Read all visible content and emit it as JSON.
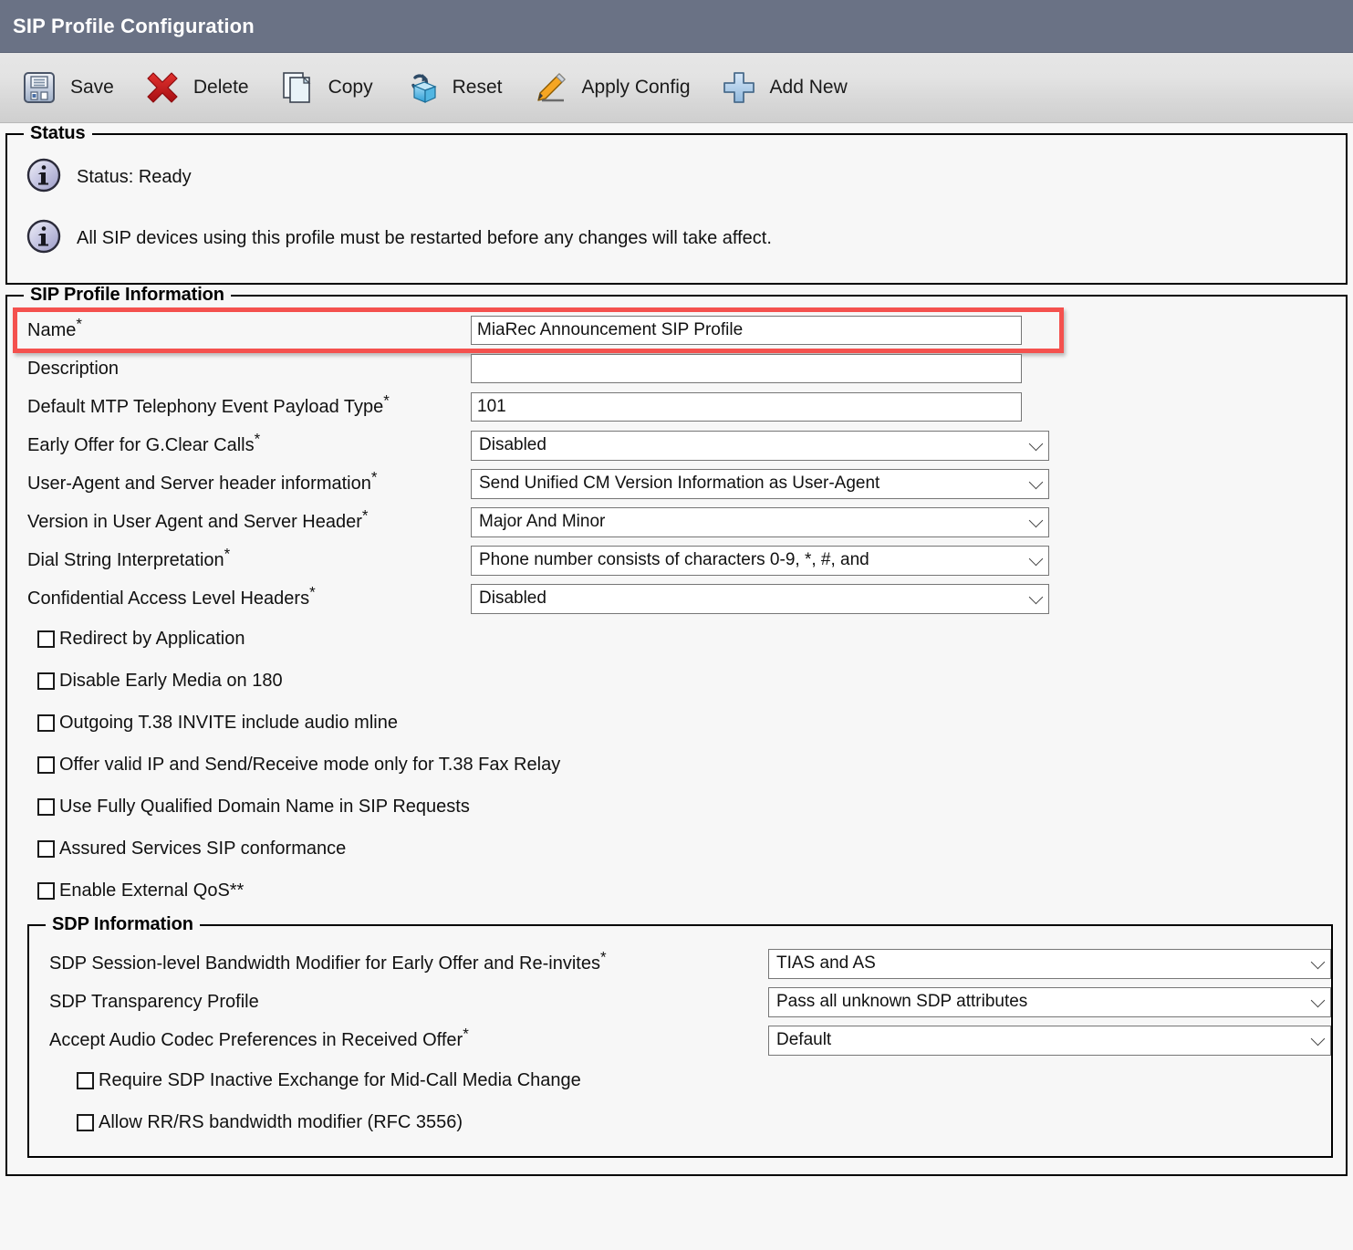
{
  "window": {
    "title": "SIP Profile Configuration",
    "header_color": "#6a7285"
  },
  "toolbar": {
    "buttons": [
      {
        "label": "Save",
        "icon": "floppy-disk-icon"
      },
      {
        "label": "Delete",
        "icon": "red-x-icon"
      },
      {
        "label": "Copy",
        "icon": "copy-pages-icon"
      },
      {
        "label": "Reset",
        "icon": "reset-cube-icon"
      },
      {
        "label": "Apply Config",
        "icon": "pencil-icon"
      },
      {
        "label": "Add New",
        "icon": "blue-plus-icon"
      }
    ]
  },
  "status": {
    "legend": "Status",
    "messages": [
      "Status: Ready",
      "All SIP devices using this profile must be restarted before any changes will take affect."
    ]
  },
  "sip_profile_information": {
    "legend": "SIP Profile Information",
    "highlight_color": "#f4514e",
    "name": {
      "label": "Name",
      "required": "*",
      "value": "MiaRec Announcement SIP Profile",
      "placeholder": ""
    },
    "description": {
      "label": "Description",
      "required": "",
      "value": "",
      "placeholder": ""
    },
    "default_mtp_payload": {
      "label": "Default MTP Telephony Event Payload Type",
      "required": "*",
      "value": "101",
      "placeholder": ""
    },
    "selects": [
      {
        "label": "Early Offer for G.Clear Calls",
        "required": "*",
        "value": "Disabled"
      },
      {
        "label": "User-Agent and Server header information",
        "required": "*",
        "value": "Send Unified CM Version Information as User-Agent"
      },
      {
        "label": "Version in User Agent and Server Header",
        "required": "*",
        "value": "Major And Minor"
      },
      {
        "label": "Dial String Interpretation",
        "required": "*",
        "value": "Phone number consists of characters 0-9, *, #, and"
      },
      {
        "label": "Confidential Access Level Headers",
        "required": "*",
        "value": "Disabled"
      }
    ],
    "checkboxes": [
      {
        "label": "Redirect by Application",
        "checked": false
      },
      {
        "label": "Disable Early Media on 180",
        "checked": false
      },
      {
        "label": "Outgoing T.38 INVITE include audio mline",
        "checked": false
      },
      {
        "label": "Offer valid IP and Send/Receive mode only for T.38 Fax Relay",
        "checked": false
      },
      {
        "label": "Use Fully Qualified Domain Name in SIP Requests",
        "checked": false
      },
      {
        "label": "Assured Services SIP conformance",
        "checked": false
      },
      {
        "label": "Enable External QoS**",
        "checked": false
      }
    ]
  },
  "sdp_information": {
    "legend": "SDP Information",
    "selects": [
      {
        "label": "SDP Session-level Bandwidth Modifier for Early Offer and Re-invites",
        "required": "*",
        "value": "TIAS and AS"
      },
      {
        "label": "SDP Transparency Profile",
        "required": "",
        "value": "Pass all unknown SDP attributes"
      },
      {
        "label": "Accept Audio Codec Preferences in Received Offer",
        "required": "*",
        "value": "Default"
      }
    ],
    "checkboxes": [
      {
        "label": "Require SDP Inactive Exchange for Mid-Call Media Change",
        "checked": false
      },
      {
        "label": "Allow RR/RS bandwidth modifier (RFC 3556)",
        "checked": false
      }
    ]
  }
}
